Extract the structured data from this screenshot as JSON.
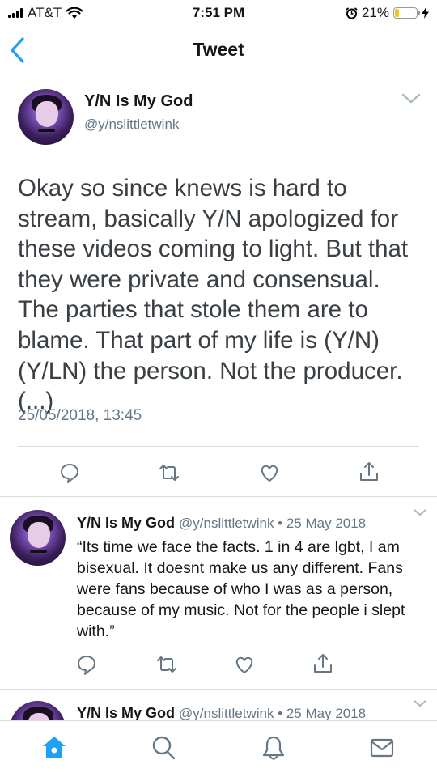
{
  "status_bar": {
    "carrier": "AT&T",
    "time": "7:51 PM",
    "battery_percent": "21%",
    "battery_level": 0.21,
    "icons": [
      "signal-icon",
      "wifi-icon",
      "alarm-icon",
      "battery-icon",
      "charging-icon"
    ]
  },
  "header": {
    "title": "Tweet",
    "back_icon": "chevron-left-icon"
  },
  "main_tweet": {
    "name": "Y/N Is My God",
    "handle": "@y/nslittletwink",
    "text": "Okay so since knews is hard to stream, basically Y/N apologized for these videos coming to light. But that they were private and consensual. The parties that stole them are to blame. That part of my life is (Y/N) (Y/LN) the person. Not the producer. (...)",
    "date": "25/05/2018, 13:45",
    "actions": [
      "reply-icon",
      "retweet-icon",
      "like-icon",
      "share-icon"
    ]
  },
  "replies": [
    {
      "name": "Y/N Is My God",
      "meta": "@y/nslittletwink • 25 May 2018",
      "text": "“Its time we face the facts. 1 in 4 are lgbt, I am bisexual. It doesnt make us any different. Fans were fans because of who I was as a person, because of my music. Not for the people i slept with.”"
    },
    {
      "name": "Y/N Is My God",
      "meta": "@y/nslittletwink • 25 May 2018",
      "text": ""
    }
  ],
  "tabbar": {
    "items": [
      "home-icon",
      "search-icon",
      "notifications-icon",
      "messages-icon"
    ],
    "active": "home-icon",
    "accent": "#1da1f2"
  },
  "colors": {
    "accent": "#1da1f2",
    "secondary_text": "#657786",
    "divider": "#d8dde1",
    "battery": "#f5c518"
  }
}
